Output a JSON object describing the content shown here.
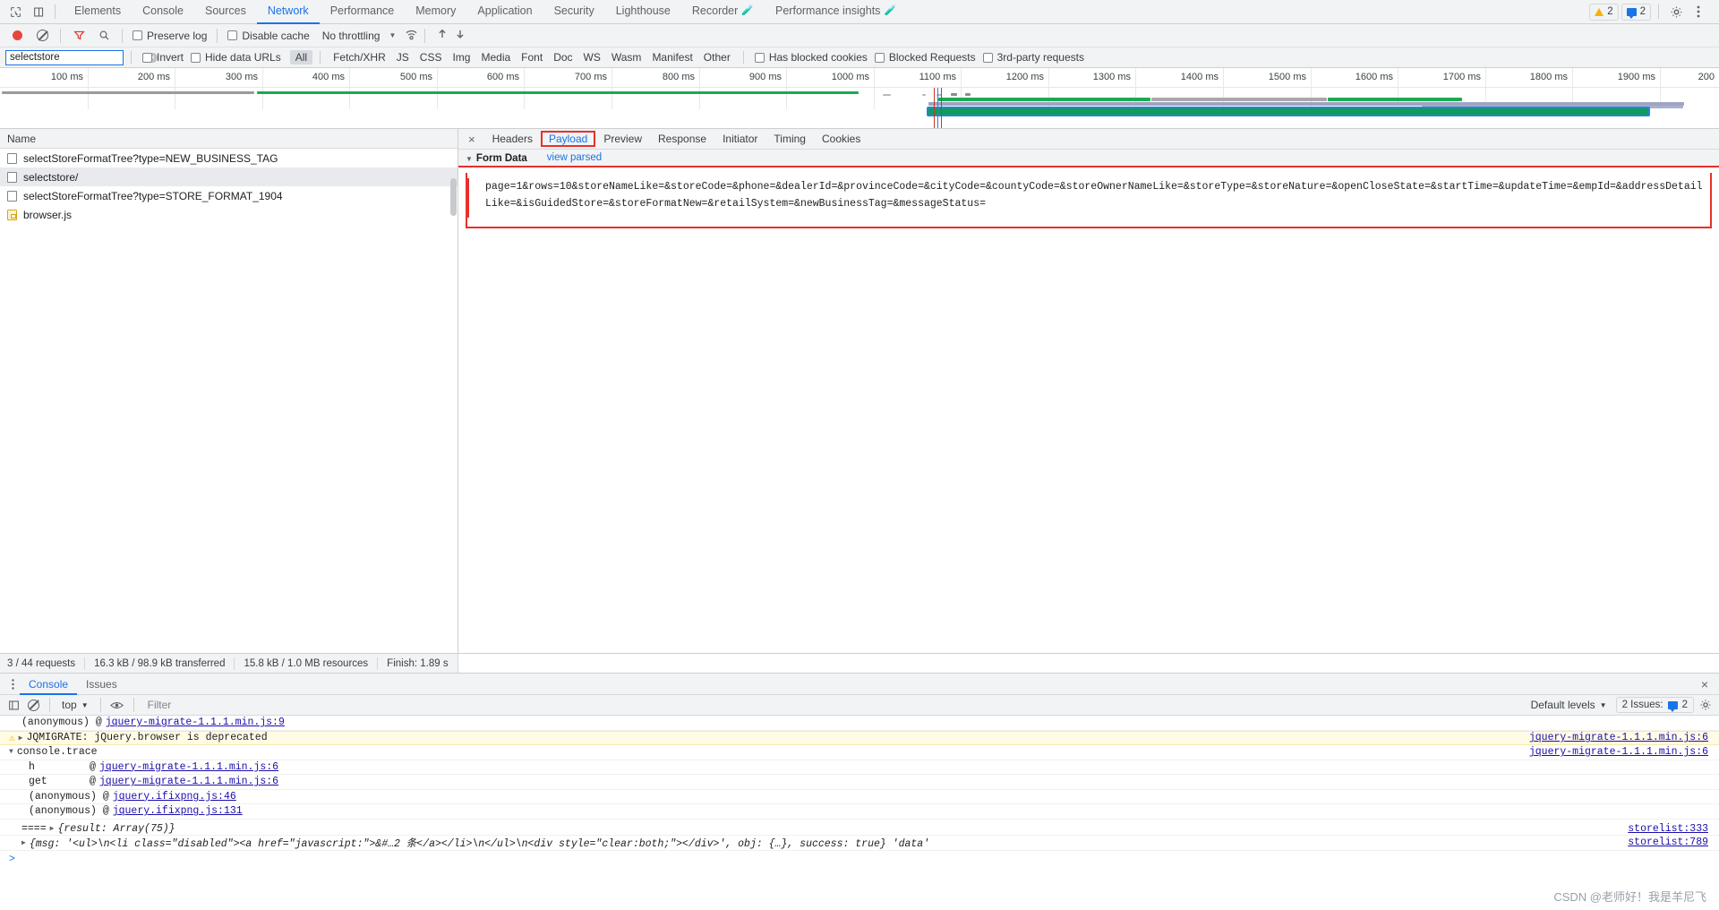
{
  "devtools": {
    "main_tabs": [
      {
        "label": "Elements",
        "active": false,
        "flask": false
      },
      {
        "label": "Console",
        "active": false,
        "flask": false
      },
      {
        "label": "Sources",
        "active": false,
        "flask": false
      },
      {
        "label": "Network",
        "active": true,
        "flask": false
      },
      {
        "label": "Performance",
        "active": false,
        "flask": false
      },
      {
        "label": "Memory",
        "active": false,
        "flask": false
      },
      {
        "label": "Application",
        "active": false,
        "flask": false
      },
      {
        "label": "Security",
        "active": false,
        "flask": false
      },
      {
        "label": "Lighthouse",
        "active": false,
        "flask": false
      },
      {
        "label": "Recorder",
        "active": false,
        "flask": true
      },
      {
        "label": "Performance insights",
        "active": false,
        "flask": true
      }
    ],
    "warning_count": "2",
    "message_count": "2"
  },
  "network_toolbar": {
    "preserve_log_label": "Preserve log",
    "disable_cache_label": "Disable cache",
    "throttling_label": "No throttling"
  },
  "filter_bar": {
    "search_value": "selectstore",
    "search_placeholder": "Filter",
    "invert_label": "Invert",
    "hide_data_urls_label": "Hide data URLs",
    "types": [
      {
        "label": "All",
        "selected": true
      },
      {
        "label": "Fetch/XHR",
        "selected": false
      },
      {
        "label": "JS",
        "selected": false
      },
      {
        "label": "CSS",
        "selected": false
      },
      {
        "label": "Img",
        "selected": false
      },
      {
        "label": "Media",
        "selected": false
      },
      {
        "label": "Font",
        "selected": false
      },
      {
        "label": "Doc",
        "selected": false
      },
      {
        "label": "WS",
        "selected": false
      },
      {
        "label": "Wasm",
        "selected": false
      },
      {
        "label": "Manifest",
        "selected": false
      },
      {
        "label": "Other",
        "selected": false
      }
    ],
    "has_blocked_cookies_label": "Has blocked cookies",
    "blocked_requests_label": "Blocked Requests",
    "third_party_label": "3rd-party requests"
  },
  "timeline": {
    "ticks": [
      "100 ms",
      "200 ms",
      "300 ms",
      "400 ms",
      "500 ms",
      "600 ms",
      "700 ms",
      "800 ms",
      "900 ms",
      "1000 ms",
      "1100 ms",
      "1200 ms",
      "1300 ms",
      "1400 ms",
      "1500 ms",
      "1600 ms",
      "1700 ms",
      "1800 ms",
      "1900 ms",
      "200"
    ]
  },
  "requests": {
    "column_header": "Name",
    "rows": [
      {
        "name": "selectStoreFormatTree?type=NEW_BUSINESS_TAG",
        "icon": "document-icon",
        "selected": false
      },
      {
        "name": "selectstore/",
        "icon": "document-icon",
        "selected": true
      },
      {
        "name": "selectStoreFormatTree?type=STORE_FORMAT_1904",
        "icon": "document-icon",
        "selected": false
      },
      {
        "name": "browser.js",
        "icon": "script-icon",
        "selected": false
      }
    ]
  },
  "detail": {
    "tabs": [
      {
        "label": "Headers",
        "active": false,
        "highlighted": false
      },
      {
        "label": "Payload",
        "active": true,
        "highlighted": true
      },
      {
        "label": "Preview",
        "active": false,
        "highlighted": false
      },
      {
        "label": "Response",
        "active": false,
        "highlighted": false
      },
      {
        "label": "Initiator",
        "active": false,
        "highlighted": false
      },
      {
        "label": "Timing",
        "active": false,
        "highlighted": false
      },
      {
        "label": "Cookies",
        "active": false,
        "highlighted": false
      }
    ],
    "form_data_title": "Form Data",
    "view_parsed_label": "view parsed",
    "payload": "page=1&rows=10&storeNameLike=&storeCode=&phone=&dealerId=&provinceCode=&cityCode=&countyCode=&storeOwnerNameLike=&storeType=&storeNature=&openCloseState=&startTime=&updateTime=&empId=&addressDetailLike=&isGuidedStore=&storeFormatNew=&retailSystem=&newBusinessTag=&messageStatus="
  },
  "status_bar": {
    "requests": "3 / 44 requests",
    "transferred": "16.3 kB / 98.9 kB transferred",
    "resources": "15.8 kB / 1.0 MB resources",
    "finish": "Finish: 1.89 s"
  },
  "drawer": {
    "tabs": [
      {
        "label": "Console",
        "active": true
      },
      {
        "label": "Issues",
        "active": false
      }
    ],
    "context_label": "top",
    "filter_placeholder": "Filter",
    "levels_label": "Default levels",
    "issues_label": "2 Issues:",
    "issues_count": "2"
  },
  "console_lines": [
    {
      "type": "frame",
      "indent": 1,
      "text": "(anonymous) @ ",
      "link": "jquery-migrate-1.1.1.min.js:9",
      "right": ""
    },
    {
      "type": "warning",
      "indent": 0,
      "text": "JQMIGRATE: jQuery.browser is deprecated",
      "link": "",
      "right": "jquery-migrate-1.1.1.min.js:6"
    },
    {
      "type": "group",
      "indent": 0,
      "text": "console.trace",
      "link": "",
      "right": "jquery-migrate-1.1.1.min.js:6"
    },
    {
      "type": "trace",
      "indent": 1,
      "fn": "h",
      "text": "@ ",
      "link": "jquery-migrate-1.1.1.min.js:6",
      "right": ""
    },
    {
      "type": "trace",
      "indent": 1,
      "fn": "get",
      "text": "@ ",
      "link": "jquery-migrate-1.1.1.min.js:6",
      "right": ""
    },
    {
      "type": "frame",
      "indent": 1,
      "text": "(anonymous) @ ",
      "link": "jquery.ifixpng.js:46",
      "right": ""
    },
    {
      "type": "frame",
      "indent": 1,
      "text": "(anonymous) @ ",
      "link": "jquery.ifixpng.js:131",
      "right": ""
    }
  ],
  "console_result": {
    "prefix": "====",
    "text": "{result: Array(75)}",
    "right": "storelist:333"
  },
  "console_msg": {
    "text": "{msg: '<ul>\\n<li class=\"disabled\"><a href=\"javascript:\">&#…2 条</a></li>\\n</ul>\\n<div style=\"clear:both;\"></div>', obj: {…}, success: true} 'data'",
    "right": "storelist:789"
  },
  "watermark": "CSDN @老师好！我是羊尼飞"
}
